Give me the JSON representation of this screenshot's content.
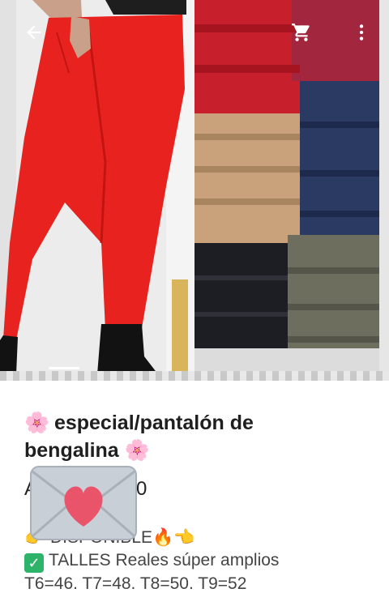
{
  "product": {
    "title_line1": "especial/pantalón de",
    "title_line2": "bengalina",
    "flower_icon": "🌸",
    "price_text": "A",
    "price_tail": "0"
  },
  "description": {
    "line1": "DISPONIBLE🔥👈",
    "line1_lead": "👉",
    "line2": "TALLES Reales súper amplios",
    "line3": "T6=46.  T7=48.  T8=50.  T9=52"
  },
  "icons": {
    "back": "arrow-left",
    "cart": "cart",
    "menu": "more-vertical",
    "envelope": "love-letter",
    "check": "check-mark"
  },
  "colors": {
    "red_pants": "#e8231f",
    "accent_green": "#2eb36b",
    "heart": "#e9546b"
  },
  "carousel": {
    "indicator_fraction": 0.2
  }
}
